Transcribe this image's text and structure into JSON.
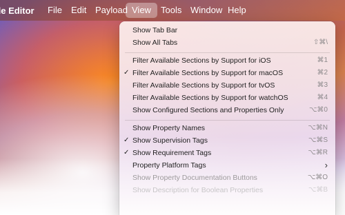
{
  "menubar": {
    "app_name": "ile Editor",
    "menus": [
      "File",
      "Edit",
      "Payload",
      "View",
      "Tools",
      "Window",
      "Help"
    ],
    "active": "View"
  },
  "view_menu": {
    "items": [
      {
        "label": "Show Tab Bar",
        "shortcut": "",
        "checked": false
      },
      {
        "label": "Show All Tabs",
        "shortcut": "⇧⌘\\",
        "checked": false
      },
      {
        "label": "Filter Available Sections by Support for iOS",
        "shortcut": "⌘1",
        "checked": false
      },
      {
        "label": "Filter Available Sections by Support for macOS",
        "shortcut": "⌘2",
        "checked": true
      },
      {
        "label": "Filter Available Sections by Support for tvOS",
        "shortcut": "⌘3",
        "checked": false
      },
      {
        "label": "Filter Available Sections by Support for watchOS",
        "shortcut": "⌘4",
        "checked": false
      },
      {
        "label": "Show Configured Sections and Properties Only",
        "shortcut": "⌥⌘0",
        "checked": false
      },
      {
        "label": "Show Property Names",
        "shortcut": "⌥⌘N",
        "checked": false
      },
      {
        "label": "Show Supervision Tags",
        "shortcut": "⌥⌘S",
        "checked": true
      },
      {
        "label": "Show Requirement Tags",
        "shortcut": "⌥⌘R",
        "checked": true
      },
      {
        "label": "Property Platform Tags",
        "shortcut": "›",
        "checked": false
      },
      {
        "label": "Show Property Documentation Buttons",
        "shortcut": "⌥⌘O",
        "checked": false
      },
      {
        "label": "Show Description for Boolean Properties",
        "shortcut": "⌥⌘B",
        "checked": false
      }
    ],
    "checkmark": "✓"
  }
}
